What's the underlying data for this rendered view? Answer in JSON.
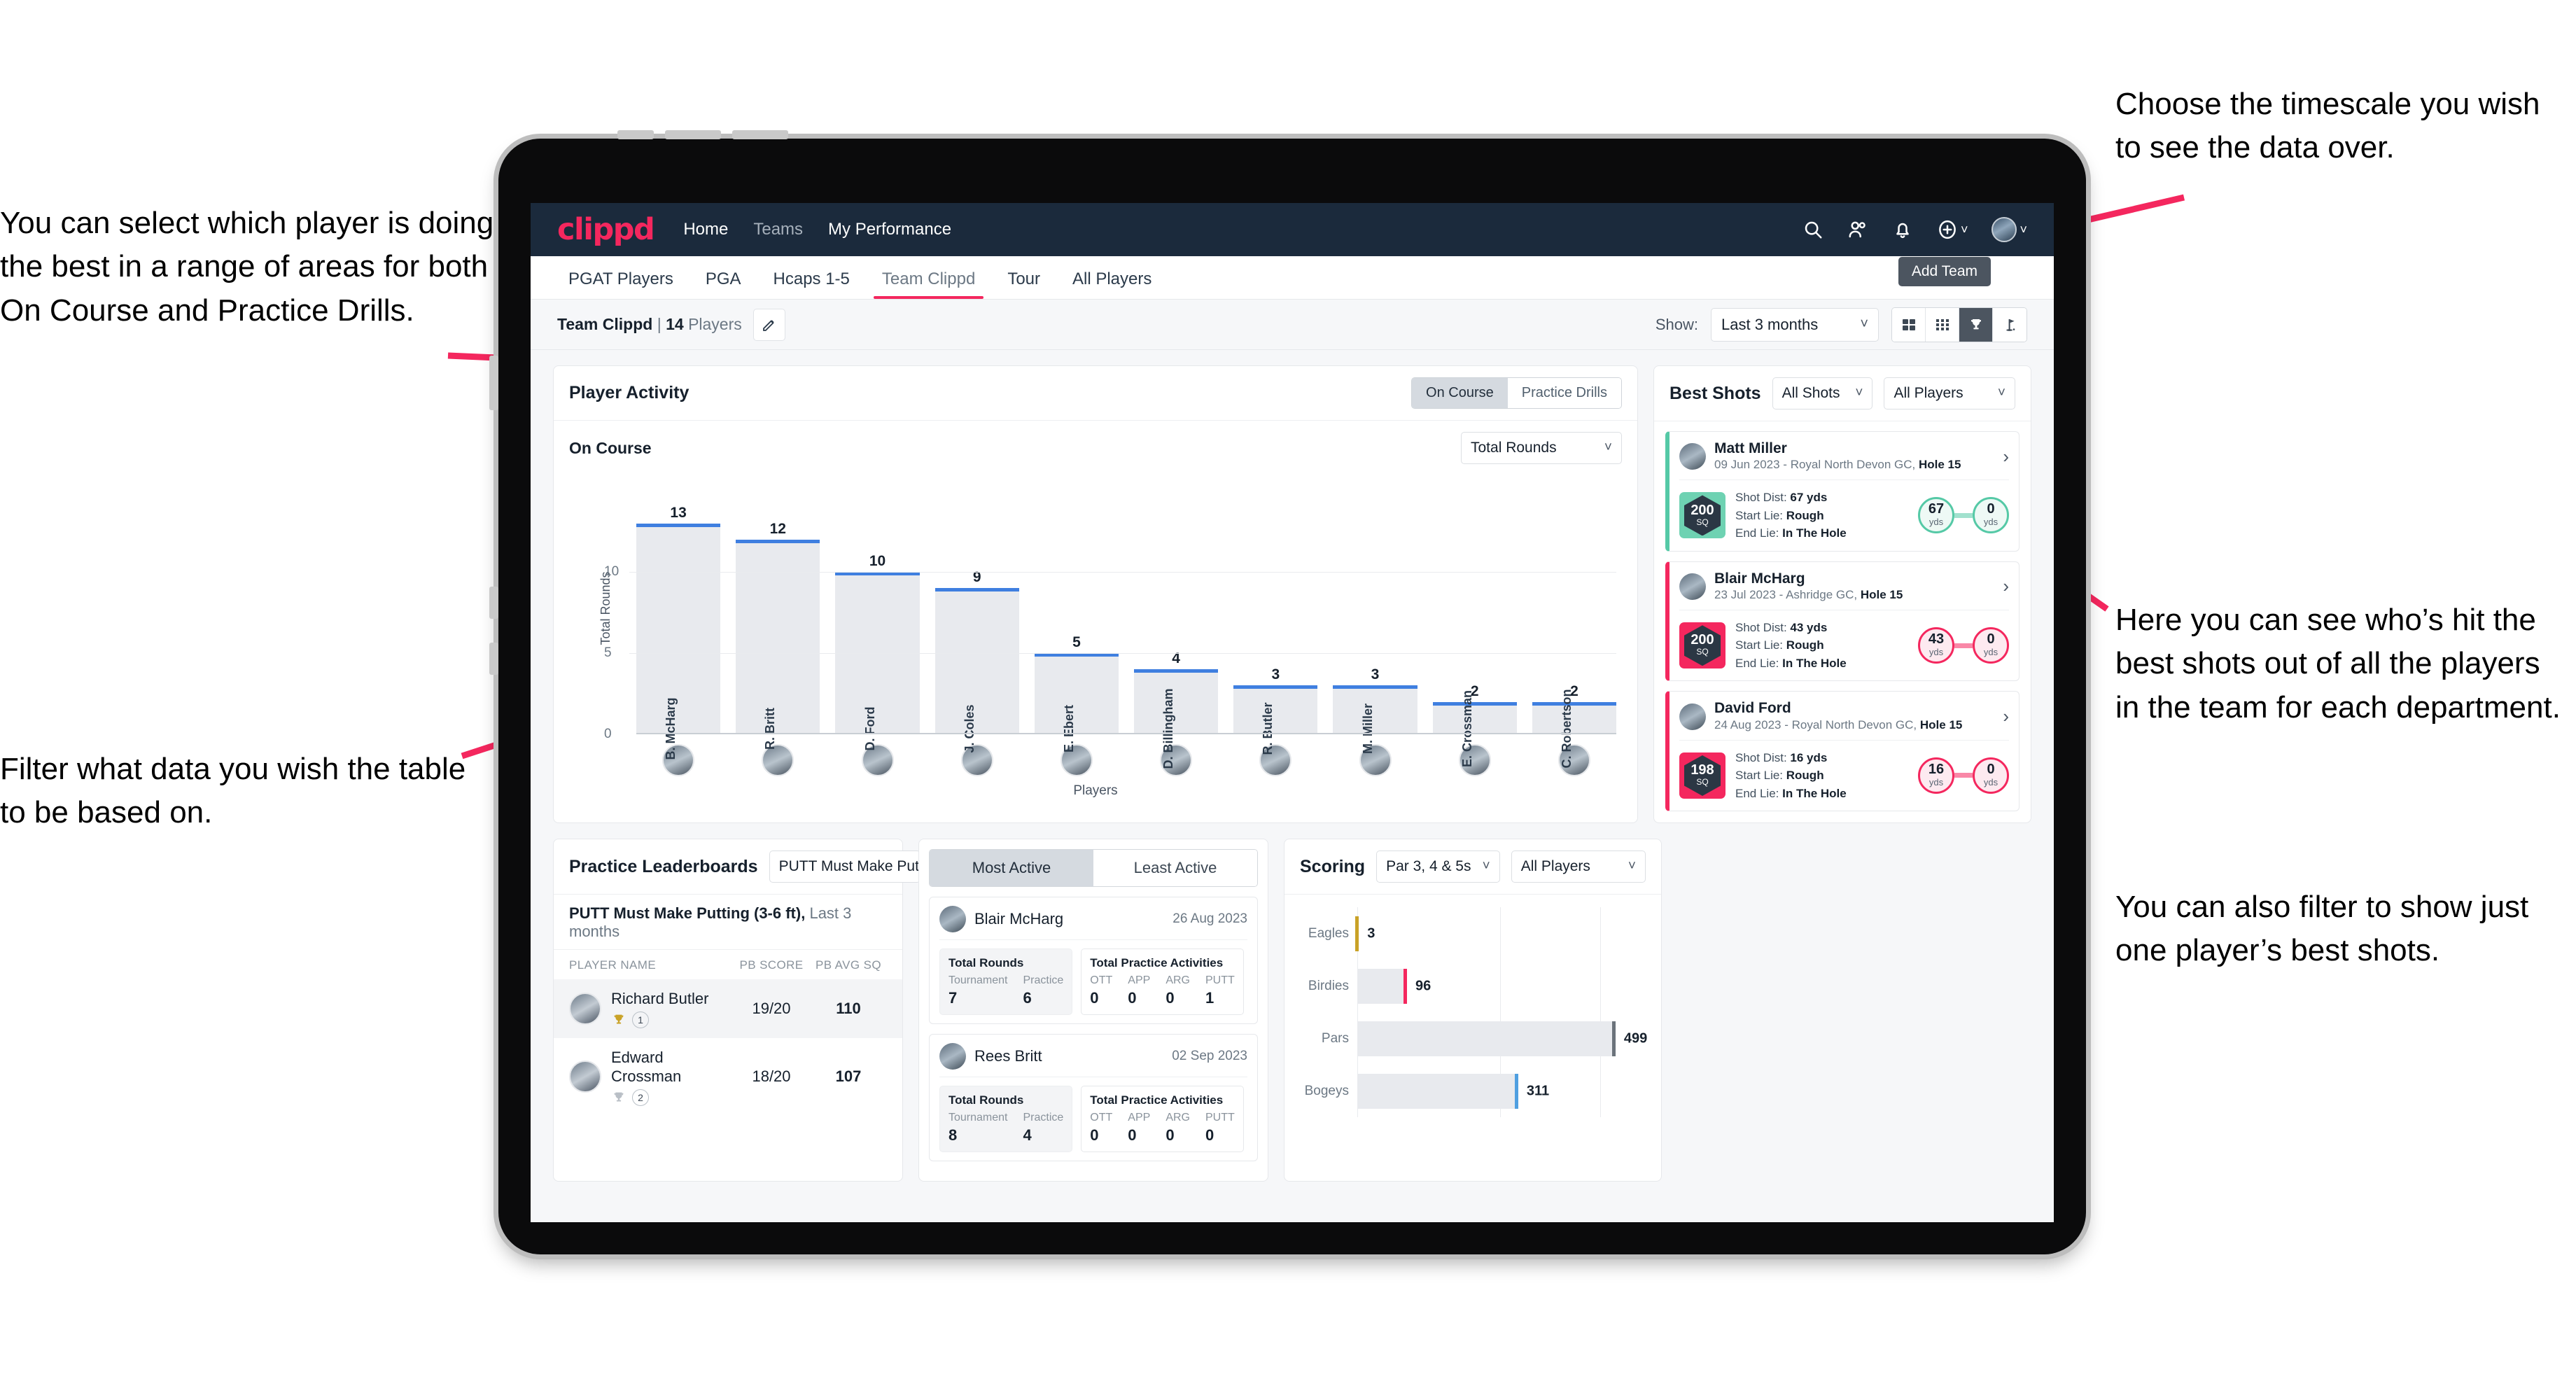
{
  "annotations": {
    "left_top": "You can select which player is doing the best in a range of areas for both On Course and Practice Drills.",
    "left_bottom": "Filter what data you wish the table to be based on.",
    "right_top": "Choose the timescale you wish to see the data over.",
    "right_middle": "Here you can see who’s hit the best shots out of all the players in the team for each department.",
    "right_bottom": "You can also filter to show just one player’s best shots."
  },
  "navbar": {
    "logo": "clippd",
    "links": [
      {
        "label": "Home",
        "dim": false
      },
      {
        "label": "Teams",
        "dim": true
      },
      {
        "label": "My Performance",
        "dim": false
      }
    ],
    "icons": [
      "search-icon",
      "people-icon",
      "bell-icon",
      "plus-circle-icon",
      "avatar"
    ]
  },
  "tabs": [
    {
      "label": "PGAT Players",
      "active": false
    },
    {
      "label": "PGA",
      "active": false
    },
    {
      "label": "Hcaps 1-5",
      "active": false
    },
    {
      "label": "Team Clippd",
      "active": true
    },
    {
      "label": "Tour",
      "active": false
    },
    {
      "label": "All Players",
      "active": false
    }
  ],
  "tooltip": {
    "add_team": "Add Team"
  },
  "toolbar": {
    "team_name": "Team Clippd",
    "separator": "|",
    "player_count": "14",
    "players_word": "Players",
    "edit_icon": "pencil-icon",
    "show_label": "Show:",
    "timescale_value": "Last 3 months",
    "view_icons": [
      "cards-view-icon",
      "grid-view-icon",
      "trophy-view-icon",
      "flag-view-icon"
    ],
    "selected_view": "trophy-view-icon"
  },
  "player_activity": {
    "title": "Player Activity",
    "segmented": {
      "options": [
        "On Course",
        "Practice Drills"
      ],
      "selected": "On Course"
    },
    "subtitle": "On Course",
    "metric_select": "Total Rounds"
  },
  "chart_data": [
    {
      "type": "bar",
      "title": "Player Activity – On Course",
      "xlabel": "Players",
      "ylabel": "Total Rounds",
      "ylim": [
        0,
        13
      ],
      "yticks": [
        0,
        5,
        10
      ],
      "grid": true,
      "categories": [
        "B. McHarg",
        "R. Britt",
        "D. Ford",
        "J. Coles",
        "E. Ebert",
        "D. Billingham",
        "R. Butler",
        "M. Miller",
        "E. Crossman",
        "C. Robertson"
      ],
      "values": [
        13,
        12,
        10,
        9,
        5,
        4,
        3,
        3,
        2,
        2
      ]
    },
    {
      "type": "bar",
      "orientation": "horizontal",
      "title": "Scoring",
      "categories": [
        "Eagles",
        "Birdies",
        "Pars",
        "Bogeys"
      ],
      "values": [
        3,
        96,
        499,
        311
      ],
      "colors": [
        "#c9a227",
        "#f4275e",
        "#6b737b",
        "#4f9fe0"
      ],
      "xlim": [
        0,
        560
      ],
      "grid": true
    }
  ],
  "best_shots": {
    "title": "Best Shots",
    "shot_filter": "All Shots",
    "player_filter": "All Players",
    "items": [
      {
        "name": "Matt Miller",
        "meta_date": "09 Jun 2023",
        "meta_course": "Royal North Devon GC,",
        "meta_hole": "Hole 15",
        "badge_value": "200",
        "badge_unit": "SQ",
        "badge_color": "#6ed2b2",
        "shot_dist_label": "Shot Dist:",
        "shot_dist": "67 yds",
        "start_lie_label": "Start Lie:",
        "start_lie": "Rough",
        "end_lie_label": "End Lie:",
        "end_lie": "In The Hole",
        "start_val": "67",
        "start_unit": "yds",
        "end_val": "0",
        "end_unit": "yds",
        "accent": "#55c9a6"
      },
      {
        "name": "Blair McHarg",
        "meta_date": "23 Jul 2023",
        "meta_course": "Ashridge GC,",
        "meta_hole": "Hole 15",
        "badge_value": "200",
        "badge_unit": "SQ",
        "badge_color": "#f4275e",
        "shot_dist_label": "Shot Dist:",
        "shot_dist": "43 yds",
        "start_lie_label": "Start Lie:",
        "start_lie": "Rough",
        "end_lie_label": "End Lie:",
        "end_lie": "In The Hole",
        "start_val": "43",
        "start_unit": "yds",
        "end_val": "0",
        "end_unit": "yds",
        "accent": "#f4275e"
      },
      {
        "name": "David Ford",
        "meta_date": "24 Aug 2023",
        "meta_course": "Royal North Devon GC,",
        "meta_hole": "Hole 15",
        "badge_value": "198",
        "badge_unit": "SQ",
        "badge_color": "#f4275e",
        "shot_dist_label": "Shot Dist:",
        "shot_dist": "16 yds",
        "start_lie_label": "Start Lie:",
        "start_lie": "Rough",
        "end_lie_label": "End Lie:",
        "end_lie": "In The Hole",
        "start_val": "16",
        "start_unit": "yds",
        "end_val": "0",
        "end_unit": "yds",
        "accent": "#f4275e"
      }
    ]
  },
  "practice_leaderboards": {
    "title": "Practice Leaderboards",
    "drill_select": "PUTT Must Make Putting ...",
    "subtitle_bold": "PUTT Must Make Putting (3-6 ft),",
    "subtitle_rest": "Last 3 months",
    "columns": [
      "PLAYER NAME",
      "PB SCORE",
      "PB AVG SQ"
    ],
    "rows": [
      {
        "name": "Richard Butler",
        "rank": "1",
        "trophy": "gold",
        "pb_score": "19/20",
        "pb_avg_sq": "110"
      },
      {
        "name": "Edward Crossman",
        "rank": "2",
        "trophy": "silver",
        "pb_score": "18/20",
        "pb_avg_sq": "107"
      }
    ]
  },
  "activity": {
    "tabs": [
      "Most Active",
      "Least Active"
    ],
    "selected": "Most Active",
    "rounds_title": "Total Rounds",
    "practice_title": "Total Practice Activities",
    "rounds_keys": [
      "Tournament",
      "Practice"
    ],
    "practice_keys": [
      "OTT",
      "APP",
      "ARG",
      "PUTT"
    ],
    "cards": [
      {
        "name": "Blair McHarg",
        "date": "26 Aug 2023",
        "rounds": [
          "7",
          "6"
        ],
        "practice": [
          "0",
          "0",
          "0",
          "1"
        ]
      },
      {
        "name": "Rees Britt",
        "date": "02 Sep 2023",
        "rounds": [
          "8",
          "4"
        ],
        "practice": [
          "0",
          "0",
          "0",
          "0"
        ]
      }
    ]
  },
  "scoring": {
    "title": "Scoring",
    "par_filter": "Par 3, 4 & 5s",
    "player_filter": "All Players"
  }
}
